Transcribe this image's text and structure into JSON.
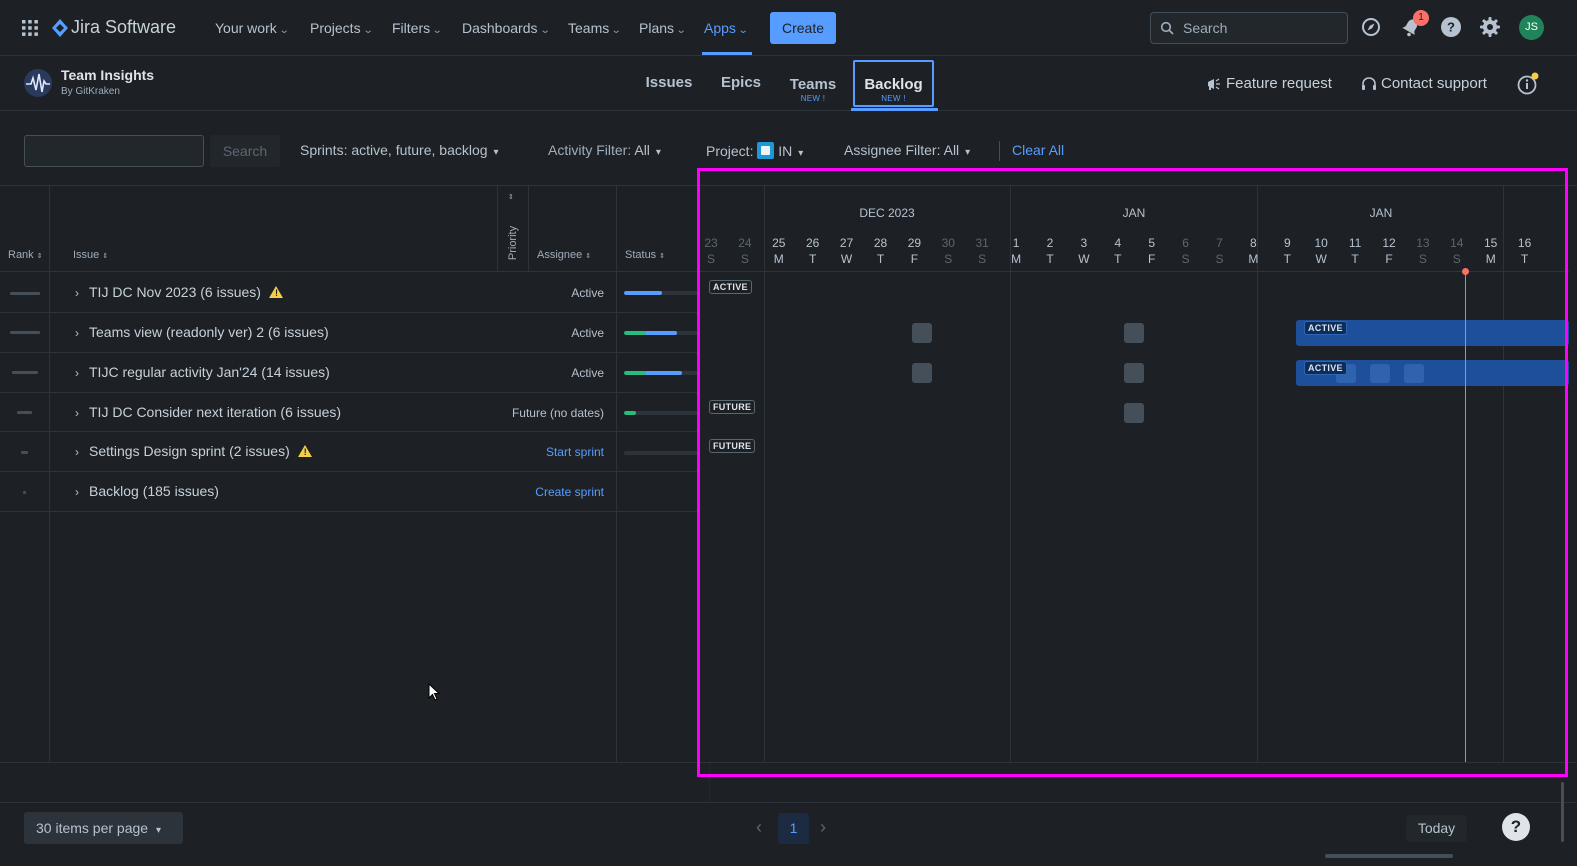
{
  "nav": {
    "product": "Jira Software",
    "items": [
      "Your work",
      "Projects",
      "Filters",
      "Dashboards",
      "Teams",
      "Plans",
      "Apps"
    ],
    "create_label": "Create",
    "search_placeholder": "Search",
    "notif_count": "1",
    "avatar_initials": "JS"
  },
  "plugin": {
    "name": "Team Insights",
    "by": "By GitKraken",
    "tabs": [
      {
        "label": "Issues",
        "badge": ""
      },
      {
        "label": "Epics",
        "badge": ""
      },
      {
        "label": "Teams",
        "badge": "NEW !"
      },
      {
        "label": "Backlog",
        "badge": "NEW !"
      }
    ],
    "feature_request": "Feature request",
    "contact_support": "Contact support"
  },
  "filters": {
    "search_button": "Search",
    "sprints": "Sprints: active, future, backlog",
    "activity_label": "Activity Filter:",
    "activity_value": "All",
    "project_label": "Project:",
    "project_value": "IN",
    "assignee_label": "Assignee Filter:",
    "assignee_value": "All",
    "clear_all": "Clear All"
  },
  "table": {
    "headers": {
      "rank": "Rank",
      "issue": "Issue",
      "priority": "Priority",
      "assignee": "Assignee",
      "status": "Status"
    },
    "rows": [
      {
        "title": "TIJ DC Nov 2023 (6 issues)",
        "warning": true,
        "status": "Active",
        "status_link": false,
        "progress_green": 0,
        "progress_blue": 0.52
      },
      {
        "title": "Teams view (readonly ver) 2 (6 issues)",
        "warning": false,
        "status": "Active",
        "status_link": false,
        "progress_green": 0.3,
        "progress_blue": 0.42
      },
      {
        "title": "TIJC regular activity Jan'24 (14 issues)",
        "warning": false,
        "status": "Active",
        "status_link": false,
        "progress_green": 0.3,
        "progress_blue": 0.48
      },
      {
        "title": "TIJ DC Consider next iteration (6 issues)",
        "warning": false,
        "status": "Future (no dates)",
        "status_link": false,
        "progress_green": 0.16,
        "progress_blue": 0
      },
      {
        "title": "Settings Design sprint (2 issues)",
        "warning": true,
        "status": "Start sprint",
        "status_link": true,
        "progress_green": 0,
        "progress_blue": 0
      },
      {
        "title": "Backlog (185 issues)",
        "warning": false,
        "status": "Create sprint",
        "status_link": true,
        "progress_green": null,
        "progress_blue": null
      }
    ]
  },
  "timeline": {
    "months": [
      "DEC 2023",
      "JAN",
      "JAN"
    ],
    "days": [
      {
        "n": "23",
        "d": "S",
        "weekend": true
      },
      {
        "n": "24",
        "d": "S",
        "weekend": true
      },
      {
        "n": "25",
        "d": "M"
      },
      {
        "n": "26",
        "d": "T"
      },
      {
        "n": "27",
        "d": "W"
      },
      {
        "n": "28",
        "d": "T"
      },
      {
        "n": "29",
        "d": "F"
      },
      {
        "n": "30",
        "d": "S",
        "weekend": true
      },
      {
        "n": "31",
        "d": "S",
        "weekend": true
      },
      {
        "n": "1",
        "d": "M"
      },
      {
        "n": "2",
        "d": "T"
      },
      {
        "n": "3",
        "d": "W"
      },
      {
        "n": "4",
        "d": "T"
      },
      {
        "n": "5",
        "d": "F"
      },
      {
        "n": "6",
        "d": "S",
        "weekend": true
      },
      {
        "n": "7",
        "d": "S",
        "weekend": true
      },
      {
        "n": "8",
        "d": "M"
      },
      {
        "n": "9",
        "d": "T"
      },
      {
        "n": "10",
        "d": "W"
      },
      {
        "n": "11",
        "d": "T"
      },
      {
        "n": "12",
        "d": "F"
      },
      {
        "n": "13",
        "d": "S",
        "weekend": true
      },
      {
        "n": "14",
        "d": "S",
        "weekend": true
      },
      {
        "n": "15",
        "d": "M"
      },
      {
        "n": "16",
        "d": "T"
      }
    ],
    "badges": {
      "active": "ACTIVE",
      "future": "FUTURE"
    }
  },
  "footer": {
    "per_page": "30 items per page",
    "page": "1",
    "today": "Today",
    "help": "?"
  },
  "colors": {
    "accent": "#579dff",
    "highlight": "#ff00ff",
    "today_line": "#f87168",
    "sprint_bar": "#1d4f9a"
  }
}
